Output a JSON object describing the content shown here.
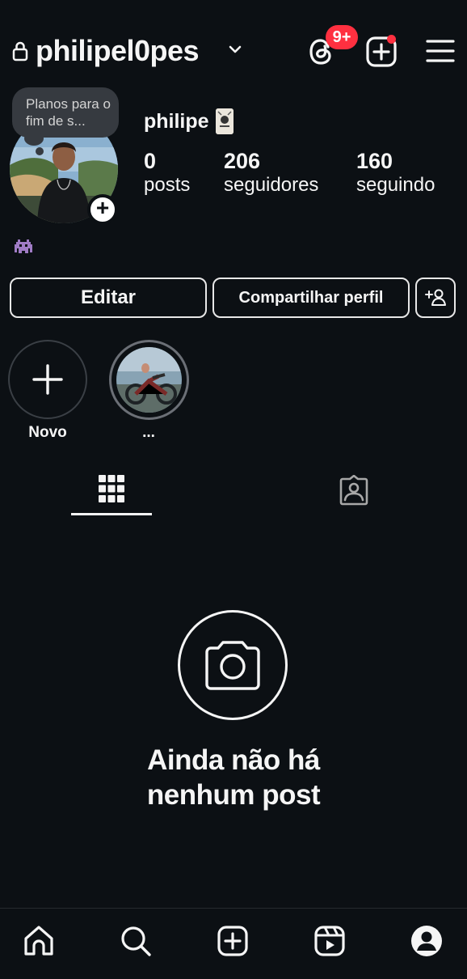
{
  "header": {
    "username": "philipel0pes",
    "notifications_badge": "9+",
    "icons": [
      "lock-icon",
      "chevron-down-icon",
      "threads-icon",
      "create-icon",
      "menu-icon"
    ]
  },
  "profile": {
    "note": "Planos para o fim de s...",
    "display_name": "philipe",
    "stats": [
      {
        "value": "0",
        "label": "posts"
      },
      {
        "value": "206",
        "label": "seguidores"
      },
      {
        "value": "160",
        "label": "seguindo"
      }
    ]
  },
  "actions": {
    "edit_label": "Editar",
    "share_label": "Compartilhar perfil"
  },
  "highlights": [
    {
      "label": "Novo"
    },
    {
      "label": "..."
    }
  ],
  "empty_state": {
    "title": "Ainda não há nenhum post"
  },
  "bottom_nav": [
    "home-icon",
    "search-icon",
    "create-icon",
    "reels-icon",
    "profile-icon"
  ],
  "colors": {
    "background": "#0c1014",
    "text": "#f5f5f5",
    "badge": "#ff3040",
    "note_bubble": "#363a40"
  }
}
